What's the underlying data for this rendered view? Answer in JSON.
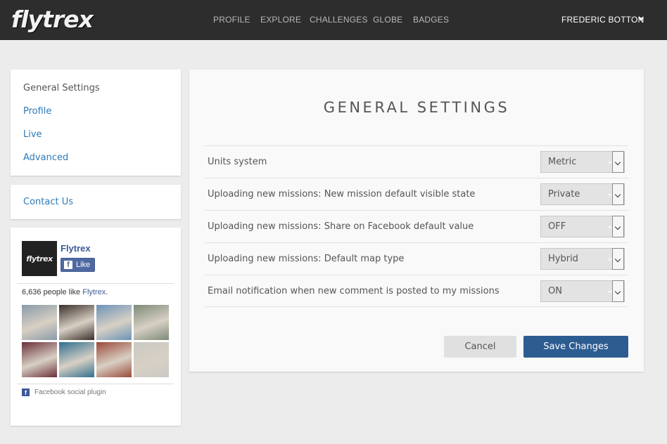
{
  "header": {
    "logo_text": "flytrex",
    "nav": [
      {
        "label": "PROFILE"
      },
      {
        "label": "EXPLORE"
      },
      {
        "label": "CHALLENGES"
      },
      {
        "label": "GLOBE"
      },
      {
        "label": "BADGES"
      }
    ],
    "user_name": "FREDERIC BOTTON"
  },
  "sidebar": {
    "items": [
      {
        "label": "General Settings",
        "active": true
      },
      {
        "label": "Profile"
      },
      {
        "label": "Live"
      },
      {
        "label": "Advanced"
      }
    ],
    "contact_label": "Contact Us"
  },
  "facebook": {
    "page_name": "Flytrex",
    "logo_text": "flytrex",
    "like_label": "Like",
    "like_icon": "f",
    "count_text": "6,636 people like ",
    "count_link": "Flytrex",
    "count_suffix": ".",
    "plugin_label": "Facebook social plugin",
    "plugin_icon": "f",
    "faces": [
      {
        "desc": "person-1",
        "color": "#8a9aa8"
      },
      {
        "desc": "person-2",
        "color": "#3a2e2a"
      },
      {
        "desc": "person-3",
        "color": "#6b93b8"
      },
      {
        "desc": "person-4",
        "color": "#7c8a78"
      },
      {
        "desc": "person-5",
        "color": "#6a2f3a"
      },
      {
        "desc": "person-6",
        "color": "#2f6f8f"
      },
      {
        "desc": "person-7",
        "color": "#9a4a3a"
      },
      {
        "desc": "person-8",
        "color": "#c9c9c4"
      }
    ]
  },
  "main": {
    "title": "GENERAL SETTINGS",
    "settings": [
      {
        "label": "Units system",
        "value": "Metric"
      },
      {
        "label": "Uploading new missions: New mission default visible state",
        "value": "Private"
      },
      {
        "label": "Uploading new missions: Share on Facebook default value",
        "value": "OFF"
      },
      {
        "label": "Uploading new missions: Default map type",
        "value": "Hybrid"
      },
      {
        "label": "Email notification when new comment is posted to my missions",
        "value": "ON"
      }
    ],
    "cancel_label": "Cancel",
    "save_label": "Save Changes"
  },
  "colors": {
    "topbar": "#2d2d2d",
    "link": "#2f7ab6",
    "primary_button": "#2d5c91",
    "facebook": "#3b5998"
  }
}
